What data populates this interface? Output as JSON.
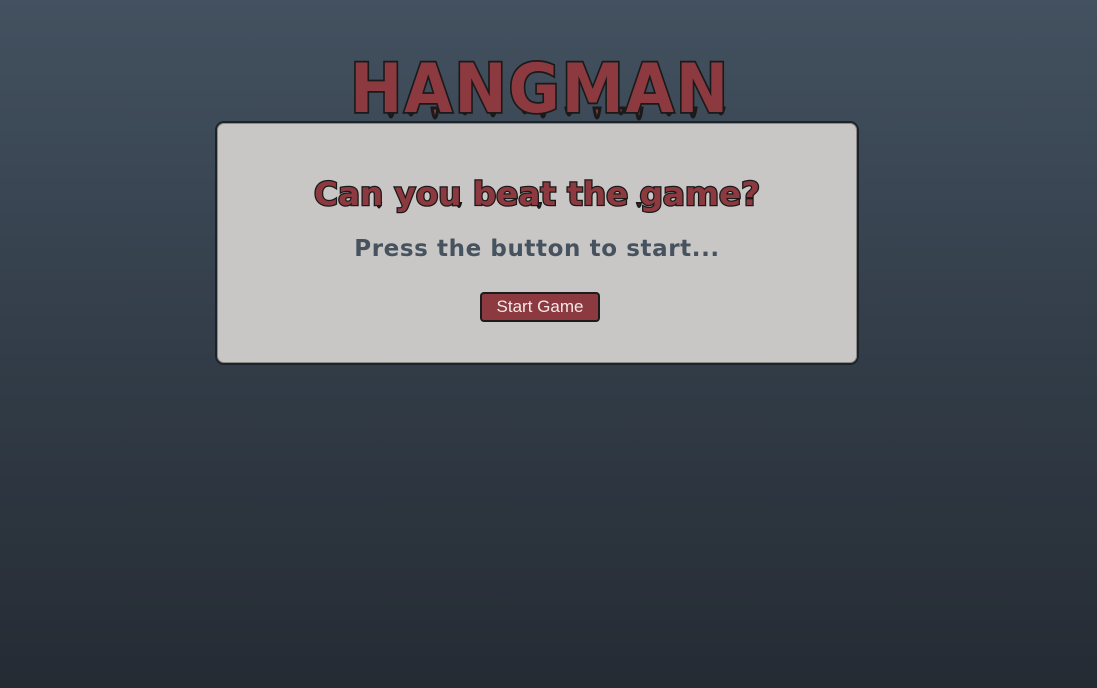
{
  "game": {
    "title": "HANGMAN",
    "tagline": "Can you beat the game?",
    "prompt": "Press the button to start...",
    "start_button_label": "Start Game"
  },
  "colors": {
    "background_top": "#435160",
    "background_bottom": "#252b33",
    "card_background": "#c9c7c6",
    "title_red": "#8c3a3f",
    "title_outline": "#1a1a1a",
    "prompt_text": "#46525e",
    "button_background": "#8c3a3f",
    "button_text": "#f3e9ea"
  }
}
